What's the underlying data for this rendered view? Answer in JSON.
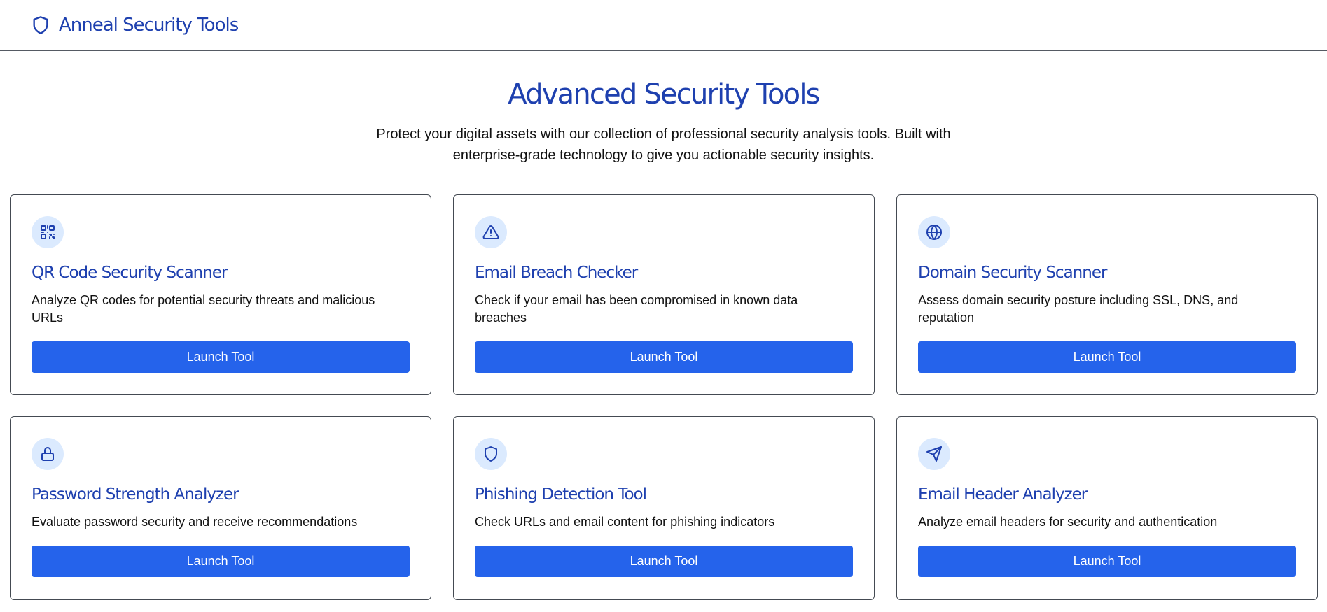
{
  "brand": {
    "name": "Anneal Security Tools",
    "icon": "shield-icon",
    "color": "#1e40af"
  },
  "hero": {
    "title": "Advanced Security Tools",
    "subtitle": "Protect your digital assets with our collection of professional security analysis tools. Built with enterprise-grade technology to give you actionable security insights."
  },
  "colors": {
    "accent": "#2563eb",
    "heading": "#1e40af",
    "icon_bg": "#dbeafe"
  },
  "tools": [
    {
      "icon": "qr-code-icon",
      "title": "QR Code Security Scanner",
      "description": "Analyze QR codes for potential security threats and malicious URLs",
      "button": "Launch Tool"
    },
    {
      "icon": "alert-triangle-icon",
      "title": "Email Breach Checker",
      "description": "Check if your email has been compromised in known data breaches",
      "button": "Launch Tool"
    },
    {
      "icon": "globe-icon",
      "title": "Domain Security Scanner",
      "description": "Assess domain security posture including SSL, DNS, and reputation",
      "button": "Launch Tool"
    },
    {
      "icon": "lock-icon",
      "title": "Password Strength Analyzer",
      "description": "Evaluate password security and receive recommendations",
      "button": "Launch Tool"
    },
    {
      "icon": "shield-icon",
      "title": "Phishing Detection Tool",
      "description": "Check URLs and email content for phishing indicators",
      "button": "Launch Tool"
    },
    {
      "icon": "send-icon",
      "title": "Email Header Analyzer",
      "description": "Analyze email headers for security and authentication",
      "button": "Launch Tool"
    }
  ]
}
